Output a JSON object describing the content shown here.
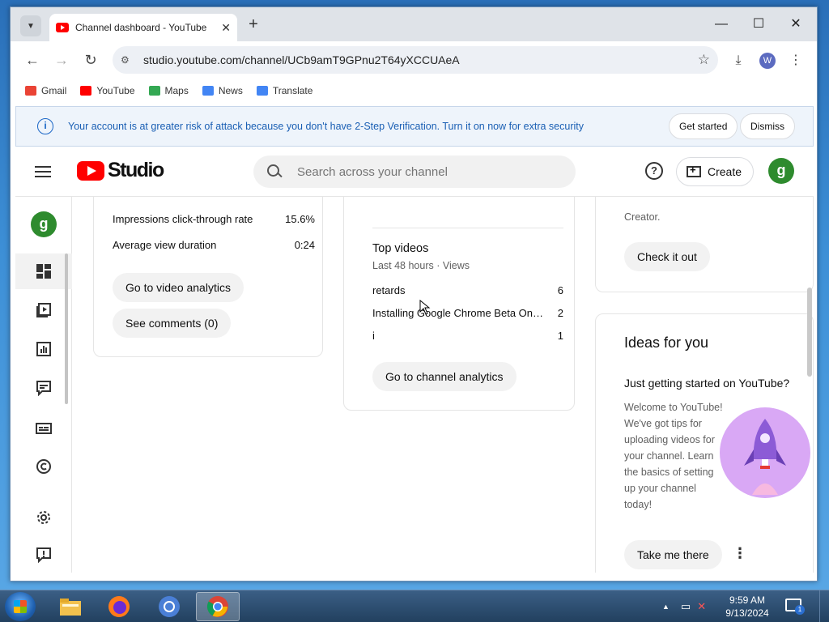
{
  "browser": {
    "tab_title": "Channel dashboard - YouTube Studio",
    "url": "studio.youtube.com/channel/UCb9amT9GPnu2T64yXCCUAeA",
    "profile_initial": "W",
    "bookmarks": [
      {
        "label": "Gmail",
        "color": "#ea4335"
      },
      {
        "label": "YouTube",
        "color": "#ff0000"
      },
      {
        "label": "Maps",
        "color": "#34a853"
      },
      {
        "label": "News",
        "color": "#4285f4"
      },
      {
        "label": "Translate",
        "color": "#4285f4"
      }
    ]
  },
  "banner": {
    "message": "Your account is at greater risk of attack because you don't have 2-Step Verification. Turn it on now for extra security",
    "get_started": "Get started",
    "dismiss": "Dismiss"
  },
  "studio": {
    "logo_text": "Studio",
    "search_placeholder": "Search across your channel",
    "create_label": "Create",
    "avatar_initial": "g",
    "accent": "#ff0000",
    "avatar_color": "#2e8b2e"
  },
  "video_analytics_card": {
    "metrics": [
      {
        "label": "Impressions click-through rate",
        "value": "15.6%"
      },
      {
        "label": "Average view duration",
        "value": "0:24"
      }
    ],
    "go_to_video_analytics": "Go to video analytics",
    "see_comments": "See comments (0)"
  },
  "channel_analytics_card": {
    "top_videos_title": "Top videos",
    "top_videos_subtitle": "Last 48 hours · Views",
    "videos": [
      {
        "title": "retards",
        "views": "6"
      },
      {
        "title": "Installing Google Chrome Beta On C...",
        "views": "2"
      },
      {
        "title": "i",
        "views": "1"
      }
    ],
    "go_to_channel_analytics": "Go to channel analytics"
  },
  "creator_card": {
    "partial_text": "Creator.",
    "check_it_out": "Check it out"
  },
  "ideas_card": {
    "title": "Ideas for you",
    "heading": "Just getting started on YouTube?",
    "body": "Welcome to YouTube! We've got tips for uploading videos for your channel. Learn the basics of setting up your channel today!",
    "take_me_there": "Take me there"
  },
  "taskbar": {
    "time": "9:59 AM",
    "date": "9/13/2024",
    "notification_count": "1"
  }
}
